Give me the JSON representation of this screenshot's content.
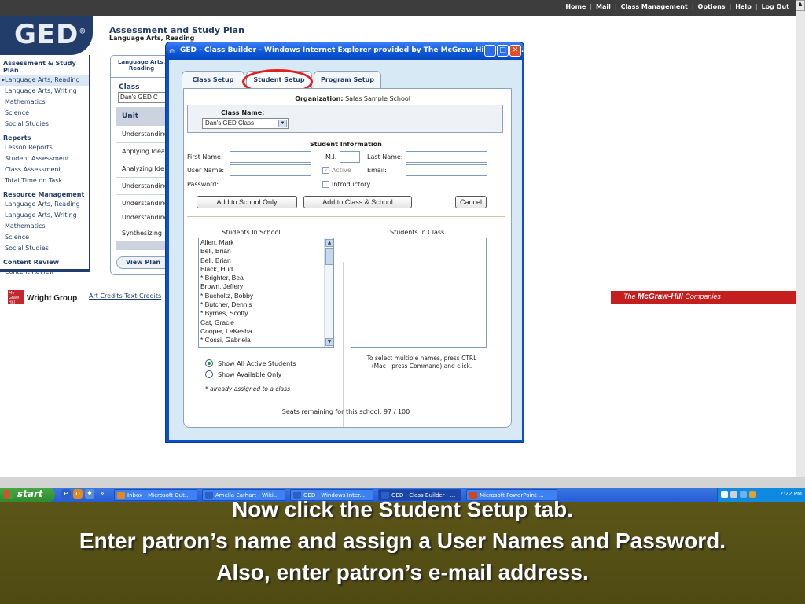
{
  "top_links": [
    "Home",
    "Mail",
    "Class Management",
    "Options",
    "Help",
    "Log Out"
  ],
  "logo": {
    "text": "GED",
    "mark": "®"
  },
  "header": {
    "title": "Assessment and Study Plan",
    "subtitle": "Language Arts, Reading"
  },
  "left_nav": {
    "sections": [
      {
        "title": "Assessment & Study Plan",
        "items": [
          "Language Arts, Reading",
          "Language Arts, Writing",
          "Mathematics",
          "Science",
          "Social Studies"
        ],
        "active_index": 0
      },
      {
        "title": "Reports",
        "items": [
          "Lesson Reports",
          "Student Assessment",
          "Class Assessment",
          "Total Time on Task"
        ]
      },
      {
        "title": "Resource Management",
        "items": [
          "Language Arts, Reading",
          "Language Arts, Writing",
          "Mathematics",
          "Science",
          "Social Studies"
        ]
      },
      {
        "title": "Content Review",
        "items": [
          "Content Review"
        ]
      }
    ]
  },
  "bg_panel": {
    "tab_label": "Language Arts, Reading",
    "class_label": "Class",
    "class_value": "Dan's GED C",
    "unit_header": "Unit",
    "unit_rows": [
      "Understanding",
      "Applying Idea",
      "Analyzing Ide",
      "Understanding",
      "Understanding",
      "Understanding",
      "Synthesizing"
    ],
    "view_plan": "View Plan"
  },
  "footer": {
    "publisher": "Wright Group",
    "credits": [
      "Art Credits",
      "Text Credits"
    ],
    "brand_prefix": "The ",
    "brand_name": "McGraw-Hill",
    "brand_suffix": " Companies"
  },
  "popup": {
    "title": "GED - Class Builder - Windows Internet Explorer provided by The McGraw-Hill Compa...",
    "tabs": [
      "Class Setup",
      "Student Setup",
      "Program Setup"
    ],
    "active_tab": "Student Setup",
    "organization_label": "Organization:",
    "organization_value": "Sales Sample School",
    "class_name_label": "Class Name:",
    "class_name_value": "Dan's GED Class",
    "student_info_title": "Student Information",
    "fields": {
      "first_name": {
        "label": "First Name:",
        "value": ""
      },
      "mi": {
        "label": "M.I.",
        "value": ""
      },
      "last_name": {
        "label": "Last Name:",
        "value": ""
      },
      "user_name": {
        "label": "User Name:",
        "value": ""
      },
      "email": {
        "label": "Email:",
        "value": ""
      },
      "password": {
        "label": "Password:",
        "value": ""
      }
    },
    "checkboxes": {
      "active": {
        "label": "Active",
        "checked": true
      },
      "introductory": {
        "label": "Introductory",
        "checked": false
      }
    },
    "buttons": {
      "add_school": "Add to School Only",
      "add_class_school": "Add to Class & School",
      "cancel": "Cancel"
    },
    "students_in_school_label": "Students In School",
    "students_in_class_label": "Students In Class",
    "students_in_school": [
      "Allen, Mark",
      "Bell, Brian",
      "Bell, Brian",
      "Black, Hud",
      "* Brighter, Bea",
      "Brown, Jeffery",
      "* Bucholtz, Bobby",
      "* Butcher, Dennis",
      "* Byrnes, Scotty",
      "Cat, Gracie",
      "Cooper, LeKesha",
      "* Cossi, Gabriela"
    ],
    "students_in_class": [],
    "radio_options": [
      "Show All Active Students",
      "Show Available Only"
    ],
    "radio_selected": 0,
    "assigned_note": "* already assigned to a class",
    "multi_select_hint": "To select multiple names, press CTRL (Mac - press Command) and click.",
    "seats_remaining": "Seats remaining for this school: 97 / 100"
  },
  "taskbar": {
    "start_label": "start",
    "items": [
      "Inbox - Microsoft Out...",
      "Amelia Earhart - Wiki...",
      "GED - Windows Inter...",
      "GED - Class Builder - ...",
      "Microsoft PowerPoint ..."
    ],
    "active_index": 3,
    "clock": "2:22 PM"
  },
  "caption": [
    "Now click the Student Setup tab.",
    "Enter patron’s name and assign a User Names and Password.",
    "Also, enter patron’s e-mail address."
  ],
  "colors": {
    "navy": "#223d6a",
    "mgh_red": "#c41e1e",
    "highlight_oval": "#e21f1f",
    "caption_bg": "#5b5518"
  }
}
